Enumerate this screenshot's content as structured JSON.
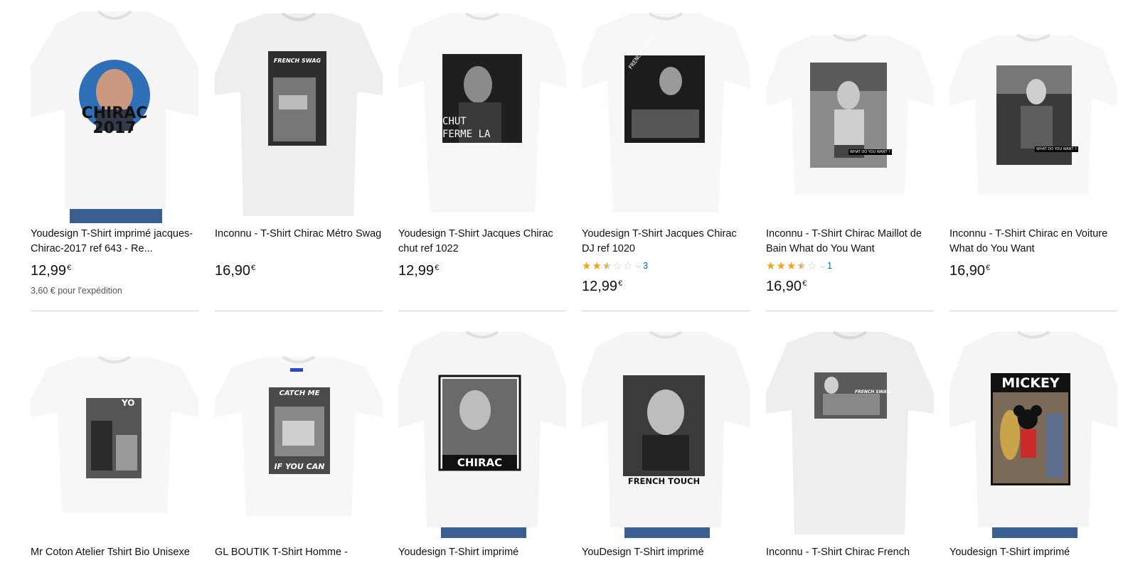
{
  "products": [
    {
      "title": "Youdesign T-Shirt imprimé jacques-Chirac-2017 ref 643 - Re...",
      "price": "12,99",
      "currency": "€",
      "shipping": "3,60 € pour l'expédition",
      "print": [
        "CHIRAC",
        "2017"
      ]
    },
    {
      "title": "Inconnu - T-Shirt Chirac Métro Swag",
      "price": "16,90",
      "currency": "€",
      "print": [
        "FRENCH SWAG"
      ]
    },
    {
      "title": "Youdesign T-Shirt Jacques Chirac chut ref 1022",
      "price": "12,99",
      "currency": "€",
      "print": [
        "CHUT",
        "FERME LA"
      ]
    },
    {
      "title": "Youdesign T-Shirt Jacques Chirac DJ ref 1020",
      "price": "12,99",
      "currency": "€",
      "rating": 2.5,
      "rating_count": "3",
      "print": [
        "FRENCH TOUCH"
      ]
    },
    {
      "title": "Inconnu - T-Shirt Chirac Maillot de Bain What do You Want",
      "price": "16,90",
      "currency": "€",
      "rating": 3.5,
      "rating_count": "1",
      "print": [
        "WHAT DO YOU WANT ?"
      ]
    },
    {
      "title": "Inconnu - T-Shirt Chirac en Voiture What do You Want",
      "price": "16,90",
      "currency": "€",
      "print": [
        "WHAT DO YOU WANT ?"
      ]
    },
    {
      "title": "Mr Coton Atelier Tshirt Bio Unisexe",
      "print": [
        "YO"
      ]
    },
    {
      "title": "GL BOUTIK T-Shirt Homme -",
      "print": [
        "CATCH ME",
        "IF YOU CAN"
      ]
    },
    {
      "title": "Youdesign T-Shirt imprimé",
      "print": [
        "CHIRAC"
      ]
    },
    {
      "title": "YouDesign T-Shirt imprimé",
      "print": [
        "FRENCH TOUCH"
      ]
    },
    {
      "title": "Inconnu - T-Shirt Chirac French",
      "print": [
        "FRENCH SWAG"
      ]
    },
    {
      "title": "Youdesign T-Shirt imprimé",
      "print": [
        "MICKEY"
      ]
    }
  ],
  "colors": {
    "star": "#f0a41a",
    "star_empty": "#c9c9c9",
    "link": "#0066c0",
    "divider": "#d5d5d5"
  }
}
